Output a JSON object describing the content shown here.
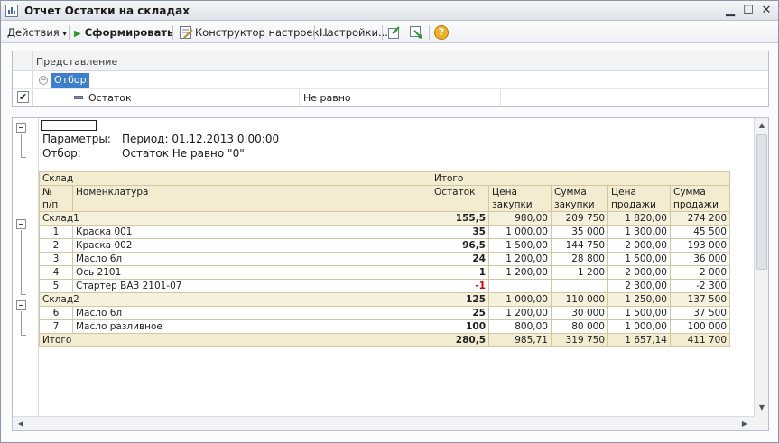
{
  "window": {
    "title": "Отчет  Остатки на складах",
    "minimize_glyph": "▁",
    "maximize_glyph": "☐",
    "close_glyph": "✕"
  },
  "toolbar": {
    "actions_label": "Действия",
    "actions_arrow": "▾",
    "generate_icon_glyph": "▶",
    "generate_label": "Сформировать",
    "constructor_label": "Конструктор настроек...",
    "settings_label": "Настройки...",
    "help_glyph": "?"
  },
  "settings_panel": {
    "header_label": "Представление",
    "filter_group_label": "Отбор",
    "collapse_glyph": "−",
    "check_glyph": "✔",
    "filter_field": "Остаток",
    "filter_condition": "Не равно"
  },
  "report": {
    "params_label": "Параметры:",
    "period_text": "Период: 01.12.2013 0:00:00",
    "filter_label": "Отбор:",
    "filter_text": "Остаток Не равно \"0\"",
    "columns": {
      "warehouse": "Склад",
      "total": "Итого",
      "num_line1": "№",
      "num_line2": "п/п",
      "item": "Номенклатура",
      "balance": "Остаток",
      "purchase_price_1": "Цена",
      "purchase_price_2": "закупки",
      "purchase_sum_1": "Сумма",
      "purchase_sum_2": "закупки",
      "sale_price_1": "Цена",
      "sale_price_2": "продажи",
      "sale_sum_1": "Сумма",
      "sale_sum_2": "продажи"
    },
    "groups": [
      {
        "name": "Склад1",
        "balance": "155,5",
        "purchase_price": "980,00",
        "purchase_sum": "209 750",
        "sale_price": "1 820,00",
        "sale_sum": "274 200",
        "rows": [
          {
            "n": "1",
            "item": "Краска 001",
            "balance": "35",
            "purchase_price": "1 000,00",
            "purchase_sum": "35 000",
            "sale_price": "1 300,00",
            "sale_sum": "45 500"
          },
          {
            "n": "2",
            "item": "Краска 002",
            "balance": "96,5",
            "purchase_price": "1 500,00",
            "purchase_sum": "144 750",
            "sale_price": "2 000,00",
            "sale_sum": "193 000"
          },
          {
            "n": "3",
            "item": "Масло 6л",
            "balance": "24",
            "purchase_price": "1 200,00",
            "purchase_sum": "28 800",
            "sale_price": "1 500,00",
            "sale_sum": "36 000"
          },
          {
            "n": "4",
            "item": "Ось 2101",
            "balance": "1",
            "purchase_price": "1 200,00",
            "purchase_sum": "1 200",
            "sale_price": "2 000,00",
            "sale_sum": "2 000"
          },
          {
            "n": "5",
            "item": "Стартер ВАЗ 2101-07",
            "balance": "-1",
            "purchase_price": "",
            "purchase_sum": "",
            "sale_price": "2 300,00",
            "sale_sum": "-2 300"
          }
        ]
      },
      {
        "name": "Склад2",
        "balance": "125",
        "purchase_price": "1 000,00",
        "purchase_sum": "110 000",
        "sale_price": "1 250,00",
        "sale_sum": "137 500",
        "rows": [
          {
            "n": "6",
            "item": "Масло 6л",
            "balance": "25",
            "purchase_price": "1 200,00",
            "purchase_sum": "30 000",
            "sale_price": "1 500,00",
            "sale_sum": "37 500"
          },
          {
            "n": "7",
            "item": "Масло разливное",
            "balance": "100",
            "purchase_price": "800,00",
            "purchase_sum": "80 000",
            "sale_price": "1 000,00",
            "sale_sum": "100 000"
          }
        ]
      }
    ],
    "grand_total": {
      "label": "Итого",
      "balance": "280,5",
      "purchase_price": "985,71",
      "purchase_sum": "319 750",
      "sale_price": "1 657,14",
      "sale_sum": "411 700"
    }
  },
  "scrollbars": {
    "up_arrow": "▲",
    "down_arrow": "▼",
    "left_arrow": "◀",
    "right_arrow": "▶"
  },
  "colors": {
    "header_bg": "#f3ecd0",
    "negative": "#d10000",
    "selection": "#3e7fcb"
  }
}
